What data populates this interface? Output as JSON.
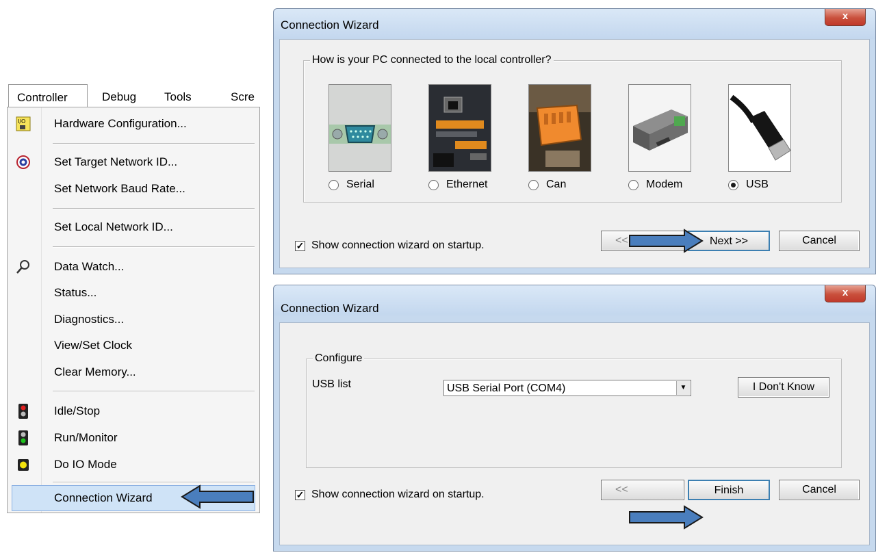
{
  "menubar": {
    "items": [
      "Controller",
      "Debug",
      "Tools",
      "Scre"
    ]
  },
  "menu": {
    "items": [
      {
        "label": "Hardware Configuration...",
        "icon": "io-config-icon"
      },
      {
        "label": "Set Target Network ID...",
        "icon": "network-target-icon"
      },
      {
        "label": "Set Network Baud Rate...",
        "icon": ""
      },
      {
        "label": "Set Local Network ID...",
        "icon": ""
      },
      {
        "label": "Data Watch...",
        "icon": "magnifier-icon"
      },
      {
        "label": "Status...",
        "icon": ""
      },
      {
        "label": "Diagnostics...",
        "icon": ""
      },
      {
        "label": "View/Set Clock",
        "icon": ""
      },
      {
        "label": "Clear Memory...",
        "icon": ""
      },
      {
        "label": "Idle/Stop",
        "icon": "red-light-icon"
      },
      {
        "label": "Run/Monitor",
        "icon": "green-light-icon"
      },
      {
        "label": "Do IO Mode",
        "icon": "yellow-light-icon"
      },
      {
        "label": "Connection Wizard",
        "icon": "",
        "highlighted": true
      }
    ]
  },
  "dialog1": {
    "title": "Connection Wizard",
    "close_label": "x",
    "group_label": "How is your PC connected to the local controller?",
    "options": [
      {
        "label": "Serial",
        "selected": false
      },
      {
        "label": "Ethernet",
        "selected": false
      },
      {
        "label": "Can",
        "selected": false
      },
      {
        "label": "Modem",
        "selected": false
      },
      {
        "label": "USB",
        "selected": true
      }
    ],
    "startup_checkbox": {
      "label": "Show connection wizard on startup.",
      "checked": true
    },
    "back_label": "<<",
    "next_label": "Next >>",
    "cancel_label": "Cancel"
  },
  "dialog2": {
    "title": "Connection Wizard",
    "close_label": "x",
    "group_label": "Configure",
    "usb_list_label": "USB list",
    "usb_list_value": "USB Serial Port (COM4)",
    "dont_know_label": "I Don't Know",
    "startup_checkbox": {
      "label": "Show connection wizard on startup.",
      "checked": true
    },
    "back_label": "<<",
    "finish_label": "Finish",
    "cancel_label": "Cancel"
  },
  "colors": {
    "menu_highlight": "#cfe3f7",
    "dialog_frame": "#c6d9ee",
    "annotation_arrow": "#4a7ebd"
  }
}
